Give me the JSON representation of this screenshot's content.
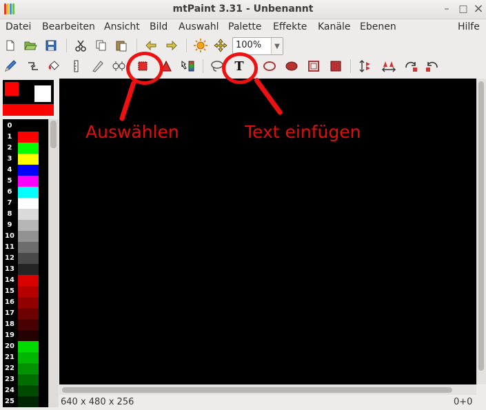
{
  "window": {
    "title": "mtPaint 3.31 - Unbenannt",
    "minimize": "–",
    "maximize": "□",
    "close": "×"
  },
  "menu": [
    "Datei",
    "Bearbeiten",
    "Ansicht",
    "Bild",
    "Auswahl",
    "Palette",
    "Effekte",
    "Kanäle",
    "Ebenen",
    "Hilfe"
  ],
  "toolbar1": {
    "zoom": "100%"
  },
  "icons": {
    "row1": [
      "new-file-icon",
      "open-folder-icon",
      "save-icon",
      "cut-icon",
      "copy-icon",
      "paste-icon",
      "undo-icon",
      "redo-icon",
      "brightness-icon",
      "pan-icon"
    ],
    "row2": [
      "paint-icon",
      "shuffle-icon",
      "flood-fill-icon",
      "line-icon",
      "smudge-icon",
      "clone-icon",
      "select-rectangle-icon",
      "select-polygon-icon",
      "gradient-icon",
      "lasso-icon",
      "text-icon",
      "ellipse-outline-icon",
      "ellipse-filled-icon",
      "rect-outline-icon",
      "rect-filled-icon",
      "flip-vertical-icon",
      "flip-horizontal-icon",
      "rotate-clockwise-icon",
      "rotate-anticlockwise-icon"
    ]
  },
  "colors": {
    "foreground": "#ff0000",
    "background": "#ffffff",
    "annotation": "#ee1111"
  },
  "palette": [
    {
      "index": "0",
      "color": "#000000"
    },
    {
      "index": "1",
      "color": "#ff0000"
    },
    {
      "index": "2",
      "color": "#00ff00"
    },
    {
      "index": "3",
      "color": "#ffff00"
    },
    {
      "index": "4",
      "color": "#0000ff"
    },
    {
      "index": "5",
      "color": "#ff00ff"
    },
    {
      "index": "6",
      "color": "#00ffff"
    },
    {
      "index": "7",
      "color": "#ffffff"
    },
    {
      "index": "8",
      "color": "#dadada"
    },
    {
      "index": "9",
      "color": "#b6b6b6"
    },
    {
      "index": "10",
      "color": "#929292"
    },
    {
      "index": "11",
      "color": "#6d6d6d"
    },
    {
      "index": "12",
      "color": "#494949"
    },
    {
      "index": "13",
      "color": "#242424"
    },
    {
      "index": "14",
      "color": "#da0000"
    },
    {
      "index": "15",
      "color": "#b60000"
    },
    {
      "index": "16",
      "color": "#920000"
    },
    {
      "index": "17",
      "color": "#6d0000"
    },
    {
      "index": "18",
      "color": "#490000"
    },
    {
      "index": "19",
      "color": "#240000"
    },
    {
      "index": "20",
      "color": "#00da00"
    },
    {
      "index": "21",
      "color": "#00b600"
    },
    {
      "index": "22",
      "color": "#009200"
    },
    {
      "index": "23",
      "color": "#006d00"
    },
    {
      "index": "24",
      "color": "#004900"
    },
    {
      "index": "25",
      "color": "#002400"
    }
  ],
  "status": {
    "image_info": "640 x 480 x 256",
    "cursor": "0+0"
  },
  "annotations": {
    "select_label": "Auswählen",
    "text_label": "Text einfügen"
  }
}
